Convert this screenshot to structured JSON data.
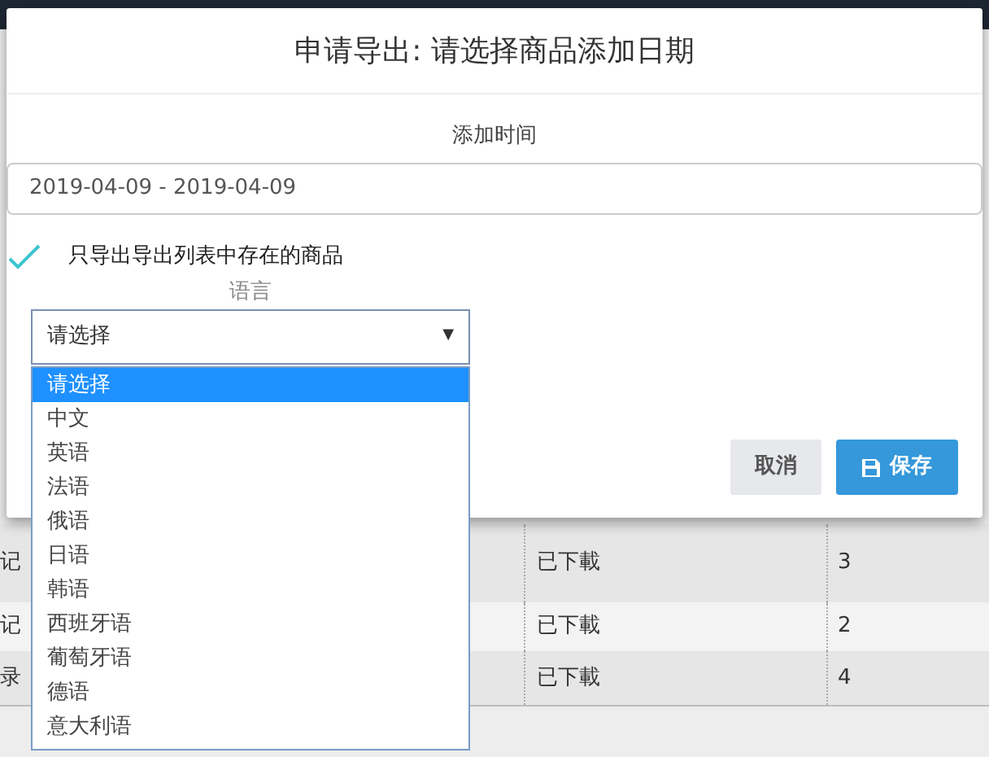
{
  "background_table": {
    "rows": [
      {
        "column_1": "记",
        "status": "已下載",
        "count": "3"
      },
      {
        "column_1": "记",
        "status": "已下載",
        "count": "2"
      },
      {
        "column_1": "录",
        "status": "已下載",
        "count": "4"
      }
    ]
  },
  "dialog": {
    "title": "申请导出: 请选择商品添加日期",
    "date_label": "添加时间",
    "date_field": {
      "value": "2019-04-09 - 2019-04-09"
    },
    "only_listed": {
      "label": "只导出导出列表中存在的商品",
      "checked": true
    },
    "language_label": "语言",
    "language_select": {
      "value": "请选择",
      "arrow": "▼",
      "expanded": true,
      "options": [
        {
          "label": "请选择",
          "selected": true
        },
        {
          "label": "中文",
          "selected": false
        },
        {
          "label": "英语",
          "selected": false
        },
        {
          "label": "法语",
          "selected": false
        },
        {
          "label": "俄语",
          "selected": false
        },
        {
          "label": "日语",
          "selected": false
        },
        {
          "label": "韩语",
          "selected": false
        },
        {
          "label": "西班牙语",
          "selected": false
        },
        {
          "label": "葡萄牙语",
          "selected": false
        },
        {
          "label": "德语",
          "selected": false
        },
        {
          "label": "意大利语",
          "selected": false
        }
      ]
    },
    "buttons": [
      {
        "label": "取消",
        "kind": "cancel"
      },
      {
        "label": "保存",
        "kind": "save"
      }
    ]
  }
}
